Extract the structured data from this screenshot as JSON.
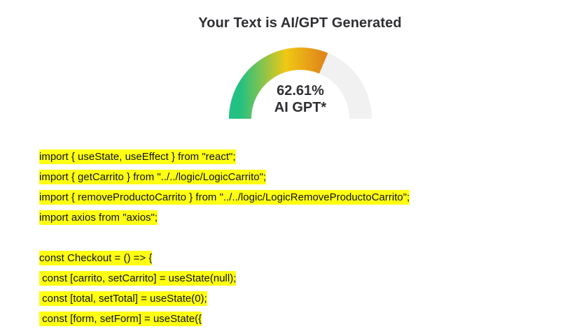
{
  "result": {
    "heading": "Your Text is AI/GPT Generated",
    "score_text": "62.61%",
    "score_label": "AI GPT*",
    "score_fraction": 0.6261,
    "colors": {
      "gradient_start": "#22c083",
      "gradient_mid": "#f0c814",
      "gradient_end": "#e0861a",
      "track": "#f1f1f1",
      "highlight": "#ffff14"
    }
  },
  "code_lines": [
    "import { useState, useEffect } from \"react\";",
    "import { getCarrito } from \"../../logic/LogicCarrito\";",
    "import { removeProductoCarrito } from \"../../logic/LogicRemoveProductoCarrito\";",
    "import axios from \"axios\";",
    "",
    "const Checkout = () => {",
    " const [carrito, setCarrito] = useState(null);",
    " const [total, setTotal] = useState(0);",
    " const [form, setForm] = useState({"
  ]
}
